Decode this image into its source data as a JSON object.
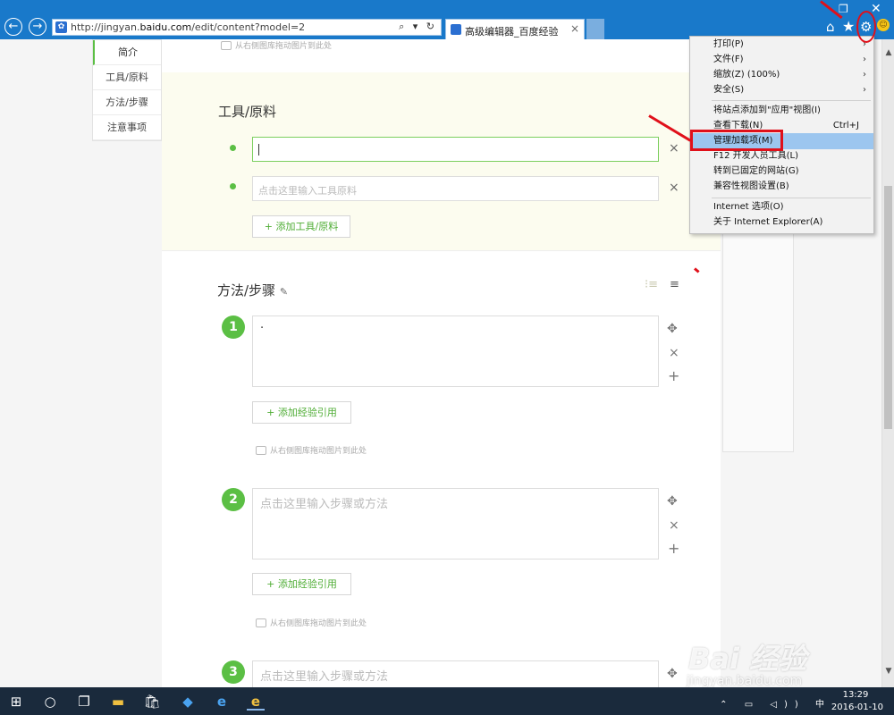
{
  "browser": {
    "url_prefix": "http://jingyan.",
    "url_domain": "baidu.com",
    "url_suffix": "/edit/content?model=2",
    "address_tools": "⌕ ▾ ↻",
    "tab_title": "高级编辑器_百度经验",
    "tab_close": "×",
    "back_icon": "←",
    "forward_icon": "→",
    "home_icon": "⌂",
    "favorites_icon": "★",
    "tools_icon": "⚙",
    "smiley_icon": "☺",
    "restore_icon": "❐",
    "close_icon": "✕"
  },
  "side_nav": {
    "items": [
      {
        "label": "简介",
        "active": true
      },
      {
        "label": "工具/原料",
        "active": false
      },
      {
        "label": "方法/步骤",
        "active": false
      },
      {
        "label": "注意事项",
        "active": false
      }
    ]
  },
  "editor": {
    "image_drop_hint": "从右侧图库拖动图片到此处",
    "tools": {
      "title": "工具/原料",
      "inputs": [
        {
          "value": "",
          "placeholder": ""
        },
        {
          "value": "",
          "placeholder": "点击这里输入工具原料"
        }
      ],
      "add_label": "+ 添加工具/原料",
      "remove_icon": "×"
    },
    "steps": {
      "title": "方法/步骤",
      "edit_icon": "✎",
      "list_icons": "⁝≡",
      "list_icon2": "≡",
      "add_ref_label": "+ 添加经验引用",
      "move_icon": "✥",
      "remove_icon": "×",
      "add_icon": "+",
      "items": [
        {
          "number": "1",
          "text": "·",
          "placeholder": ""
        },
        {
          "number": "2",
          "text": "",
          "placeholder": "点击这里输入步骤或方法"
        },
        {
          "number": "3",
          "text": "",
          "placeholder": "点击这里输入步骤或方法"
        }
      ]
    }
  },
  "tools_menu": {
    "items": [
      {
        "label": "打印(P)",
        "arrow": "›",
        "shortcut": "",
        "highlighted": false
      },
      {
        "label": "文件(F)",
        "arrow": "›",
        "shortcut": "",
        "highlighted": false
      },
      {
        "label": "缩放(Z) (100%)",
        "arrow": "›",
        "shortcut": "",
        "highlighted": false
      },
      {
        "label": "安全(S)",
        "arrow": "›",
        "shortcut": "",
        "highlighted": false
      },
      {
        "label": "将站点添加到\"应用\"视图(I)",
        "arrow": "",
        "shortcut": "",
        "highlighted": false
      },
      {
        "label": "查看下载(N)",
        "arrow": "",
        "shortcut": "Ctrl+J",
        "highlighted": false
      },
      {
        "label": "管理加载项(M)",
        "arrow": "",
        "shortcut": "",
        "highlighted": true
      },
      {
        "label": "F12 开发人员工具(L)",
        "arrow": "",
        "shortcut": "",
        "highlighted": false
      },
      {
        "label": "转到已固定的网站(G)",
        "arrow": "",
        "shortcut": "",
        "highlighted": false
      },
      {
        "label": "兼容性视图设置(B)",
        "arrow": "",
        "shortcut": "",
        "highlighted": false
      },
      {
        "label": "Internet 选项(O)",
        "arrow": "",
        "shortcut": "",
        "highlighted": false
      },
      {
        "label": "关于 Internet Explorer(A)",
        "arrow": "",
        "shortcut": "",
        "highlighted": false
      }
    ]
  },
  "watermark": {
    "line1": "Bai 经验",
    "line2": "jingyan.baidu.com"
  },
  "taskbar": {
    "start_icon": "⊞",
    "search_icon": "○",
    "taskview_icon": "❐",
    "explorer_icon": "▬",
    "store_icon": "🛍",
    "app_icon": "◆",
    "edge_icon": "e",
    "ie_icon": "e",
    "tray_icons": "⌃ ▭ ◁)) 中",
    "time": "13:29",
    "date": "2016-01-10"
  },
  "colors": {
    "accent_green": "#5bbf44",
    "chrome_blue": "#1979ca",
    "annotation_red": "#e0101a",
    "menu_highlight": "#9cc6ef"
  }
}
